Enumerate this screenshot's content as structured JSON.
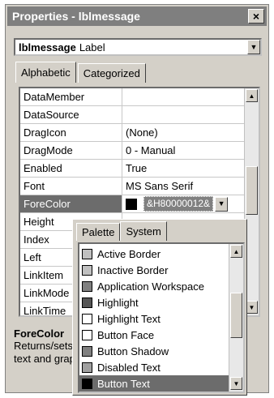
{
  "window": {
    "title": "Properties - lblmessage",
    "close_glyph": "×"
  },
  "object_combo": {
    "name": "lblmessage",
    "type": "Label",
    "arrow": "▼"
  },
  "tabs": [
    {
      "label": "Alphabetic",
      "active": true
    },
    {
      "label": "Categorized",
      "active": false
    }
  ],
  "properties": [
    {
      "name": "DataMember",
      "value": ""
    },
    {
      "name": "DataSource",
      "value": ""
    },
    {
      "name": "DragIcon",
      "value": "(None)"
    },
    {
      "name": "DragMode",
      "value": "0 - Manual"
    },
    {
      "name": "Enabled",
      "value": "True"
    },
    {
      "name": "Font",
      "value": "MS Sans Serif"
    },
    {
      "name": "ForeColor",
      "value": "&H80000012&",
      "selected": true
    },
    {
      "name": "Height",
      "value": ""
    },
    {
      "name": "Index",
      "value": ""
    },
    {
      "name": "Left",
      "value": ""
    },
    {
      "name": "LinkItem",
      "value": ""
    },
    {
      "name": "LinkMode",
      "value": ""
    },
    {
      "name": "LinkTime",
      "value": ""
    }
  ],
  "color_popup": {
    "tabs": [
      {
        "label": "Palette",
        "active": false
      },
      {
        "label": "System",
        "active": true
      }
    ],
    "items": [
      {
        "label": "Active Border",
        "color": "#c0c0c0"
      },
      {
        "label": "Inactive Border",
        "color": "#c0c0c0"
      },
      {
        "label": "Application Workspace",
        "color": "#808080"
      },
      {
        "label": "Highlight",
        "color": "#555555"
      },
      {
        "label": "Highlight Text",
        "color": "#ffffff"
      },
      {
        "label": "Button Face",
        "color": "#ffffff"
      },
      {
        "label": "Button Shadow",
        "color": "#808080"
      },
      {
        "label": "Disabled Text",
        "color": "#a0a0a0"
      },
      {
        "label": "Button Text",
        "color": "#000000",
        "selected": true
      }
    ]
  },
  "description": {
    "title": "ForeColor",
    "text": "Returns/sets the foreground color used to display text and graphics in an object."
  }
}
